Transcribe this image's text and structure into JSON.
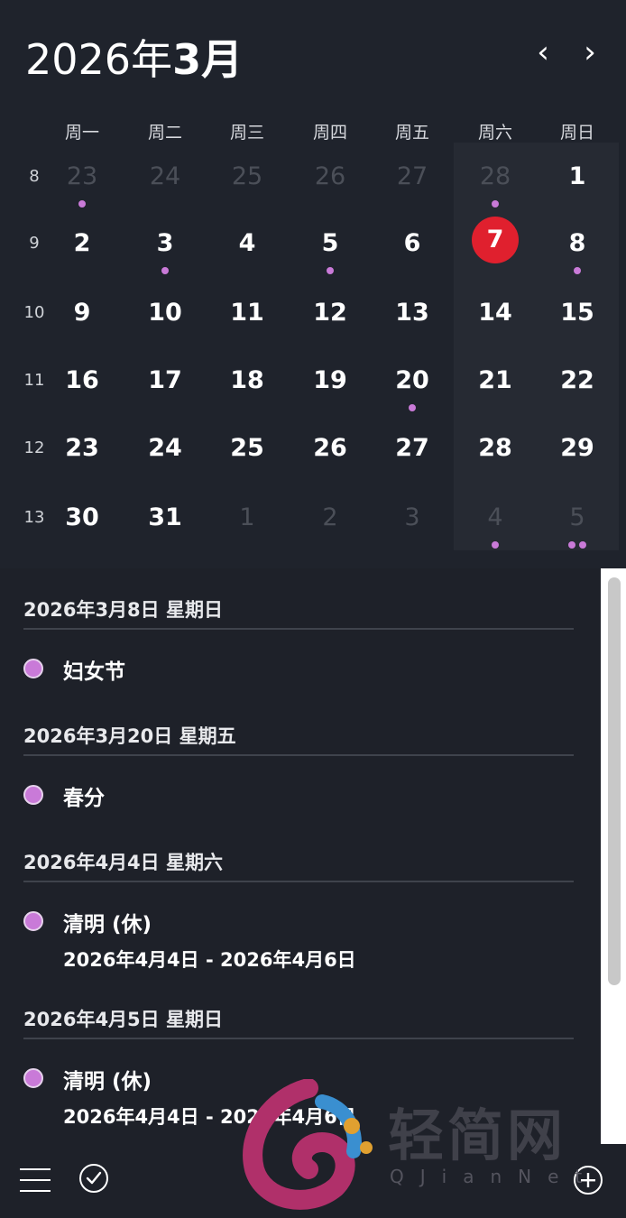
{
  "header": {
    "year_label": "2026年",
    "month_label": "3月"
  },
  "nav": {
    "prev": "‹",
    "next": "›"
  },
  "weekdays": [
    "周一",
    "周二",
    "周三",
    "周四",
    "周五",
    "周六",
    "周日"
  ],
  "weeks": [
    {
      "num": "8",
      "days": [
        {
          "d": "23",
          "muted": true,
          "dots": 1
        },
        {
          "d": "24",
          "muted": true
        },
        {
          "d": "25",
          "muted": true
        },
        {
          "d": "26",
          "muted": true
        },
        {
          "d": "27",
          "muted": true
        },
        {
          "d": "28",
          "muted": true,
          "dots": 1
        },
        {
          "d": "1"
        }
      ]
    },
    {
      "num": "9",
      "days": [
        {
          "d": "2"
        },
        {
          "d": "3",
          "dots": 1
        },
        {
          "d": "4"
        },
        {
          "d": "5",
          "dots": 1
        },
        {
          "d": "6"
        },
        {
          "d": "7",
          "today": true
        },
        {
          "d": "8",
          "dots": 1
        }
      ]
    },
    {
      "num": "10",
      "days": [
        {
          "d": "9"
        },
        {
          "d": "10"
        },
        {
          "d": "11"
        },
        {
          "d": "12"
        },
        {
          "d": "13"
        },
        {
          "d": "14"
        },
        {
          "d": "15"
        }
      ]
    },
    {
      "num": "11",
      "days": [
        {
          "d": "16"
        },
        {
          "d": "17"
        },
        {
          "d": "18"
        },
        {
          "d": "19"
        },
        {
          "d": "20",
          "dots": 1
        },
        {
          "d": "21"
        },
        {
          "d": "22"
        }
      ]
    },
    {
      "num": "12",
      "days": [
        {
          "d": "23"
        },
        {
          "d": "24"
        },
        {
          "d": "25"
        },
        {
          "d": "26"
        },
        {
          "d": "27"
        },
        {
          "d": "28"
        },
        {
          "d": "29"
        }
      ]
    },
    {
      "num": "13",
      "days": [
        {
          "d": "30"
        },
        {
          "d": "31"
        },
        {
          "d": "1",
          "muted": true
        },
        {
          "d": "2",
          "muted": true
        },
        {
          "d": "3",
          "muted": true
        },
        {
          "d": "4",
          "muted": true,
          "dots": 1
        },
        {
          "d": "5",
          "muted": true,
          "dots": 2
        }
      ]
    }
  ],
  "events": [
    {
      "date": "2026年3月8日 星期日",
      "title": "妇女节",
      "range": ""
    },
    {
      "date": "2026年3月20日 星期五",
      "title": "春分",
      "range": ""
    },
    {
      "date": "2026年4月4日 星期六",
      "title": "清明 (休)",
      "range": "2026年4月4日 - 2026年4月6日"
    },
    {
      "date": "2026年4月5日 星期日",
      "title": "清明 (休)",
      "range": "2026年4月4日 - 2026年4月6日"
    }
  ],
  "colors": {
    "accent_today": "#e0202e",
    "event_dot": "#c97ad8",
    "background": "#1e2129"
  },
  "icons": {
    "menu": "hamburger-menu-icon",
    "tasks": "check-circle-icon",
    "add": "plus-circle-icon"
  },
  "watermark": {
    "text": "轻简网",
    "sub": "QJianNet"
  }
}
